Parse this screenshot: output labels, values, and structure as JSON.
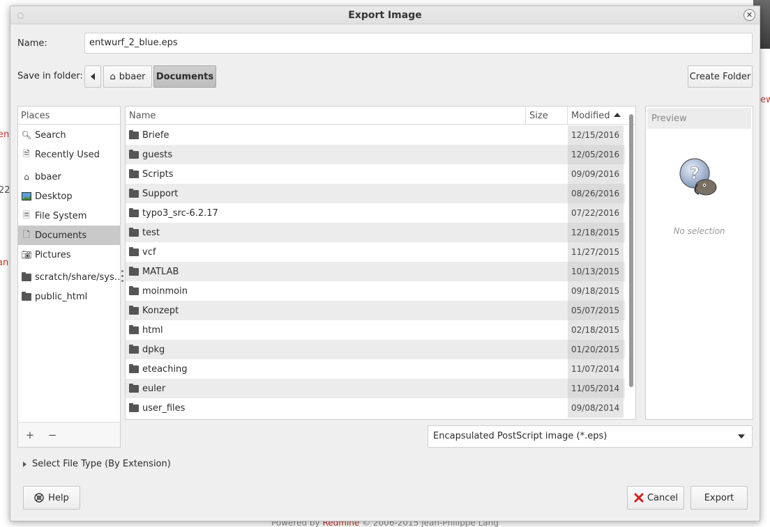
{
  "dialog": {
    "title": "Export Image",
    "name_label": "Name:",
    "name_value": "entwurf_2_blue.eps",
    "save_in_label": "Save in folder:",
    "breadcrumbs": [
      "bbaer",
      "Documents"
    ],
    "create_folder": "Create Folder"
  },
  "places": {
    "header": "Places",
    "items": [
      {
        "label": "Search",
        "icon": "search-icon"
      },
      {
        "label": "Recently Used",
        "icon": "recent-icon"
      },
      {
        "label": "bbaer",
        "icon": "home-icon"
      },
      {
        "label": "Desktop",
        "icon": "desktop-icon"
      },
      {
        "label": "File System",
        "icon": "filesystem-icon"
      },
      {
        "label": "Documents",
        "icon": "documents-icon"
      },
      {
        "label": "Pictures",
        "icon": "pictures-icon"
      },
      {
        "label": "scratch/share/sys…",
        "icon": "folder-icon"
      },
      {
        "label": "public_html",
        "icon": "folder-icon"
      }
    ]
  },
  "files": {
    "columns": {
      "name": "Name",
      "size": "Size",
      "modified": "Modified"
    },
    "rows": [
      {
        "name": "Briefe",
        "modified": "12/15/2016"
      },
      {
        "name": "guests",
        "modified": "12/05/2016"
      },
      {
        "name": "Scripts",
        "modified": "09/09/2016"
      },
      {
        "name": "Support",
        "modified": "08/26/2016"
      },
      {
        "name": "typo3_src-6.2.17",
        "modified": "07/22/2016"
      },
      {
        "name": "test",
        "modified": "12/18/2015"
      },
      {
        "name": "vcf",
        "modified": "11/27/2015"
      },
      {
        "name": "MATLAB",
        "modified": "10/13/2015"
      },
      {
        "name": "moinmoin",
        "modified": "09/18/2015"
      },
      {
        "name": "Konzept",
        "modified": "05/07/2015"
      },
      {
        "name": "html",
        "modified": "02/18/2015"
      },
      {
        "name": "dpkg",
        "modified": "01/20/2015"
      },
      {
        "name": "eteaching",
        "modified": "11/07/2014"
      },
      {
        "name": "euler",
        "modified": "11/05/2014"
      },
      {
        "name": "user_files",
        "modified": "09/08/2014"
      }
    ]
  },
  "preview": {
    "header": "Preview",
    "empty": "No selection"
  },
  "filetype": {
    "selected": "Encapsulated PostScript image (*.eps)",
    "expander": "Select File Type (By Extension)"
  },
  "buttons": {
    "help": "Help",
    "cancel": "Cancel",
    "export": "Export"
  },
  "background": {
    "footer_prefix": "Powered by ",
    "footer_link": "Redmine",
    "footer_suffix": " © 2006-2015 Jean-Philippe Lang"
  },
  "colors": {
    "selection": "#c9c9c9",
    "dialog_bg": "#efefef",
    "link_red": "#c0392b"
  }
}
